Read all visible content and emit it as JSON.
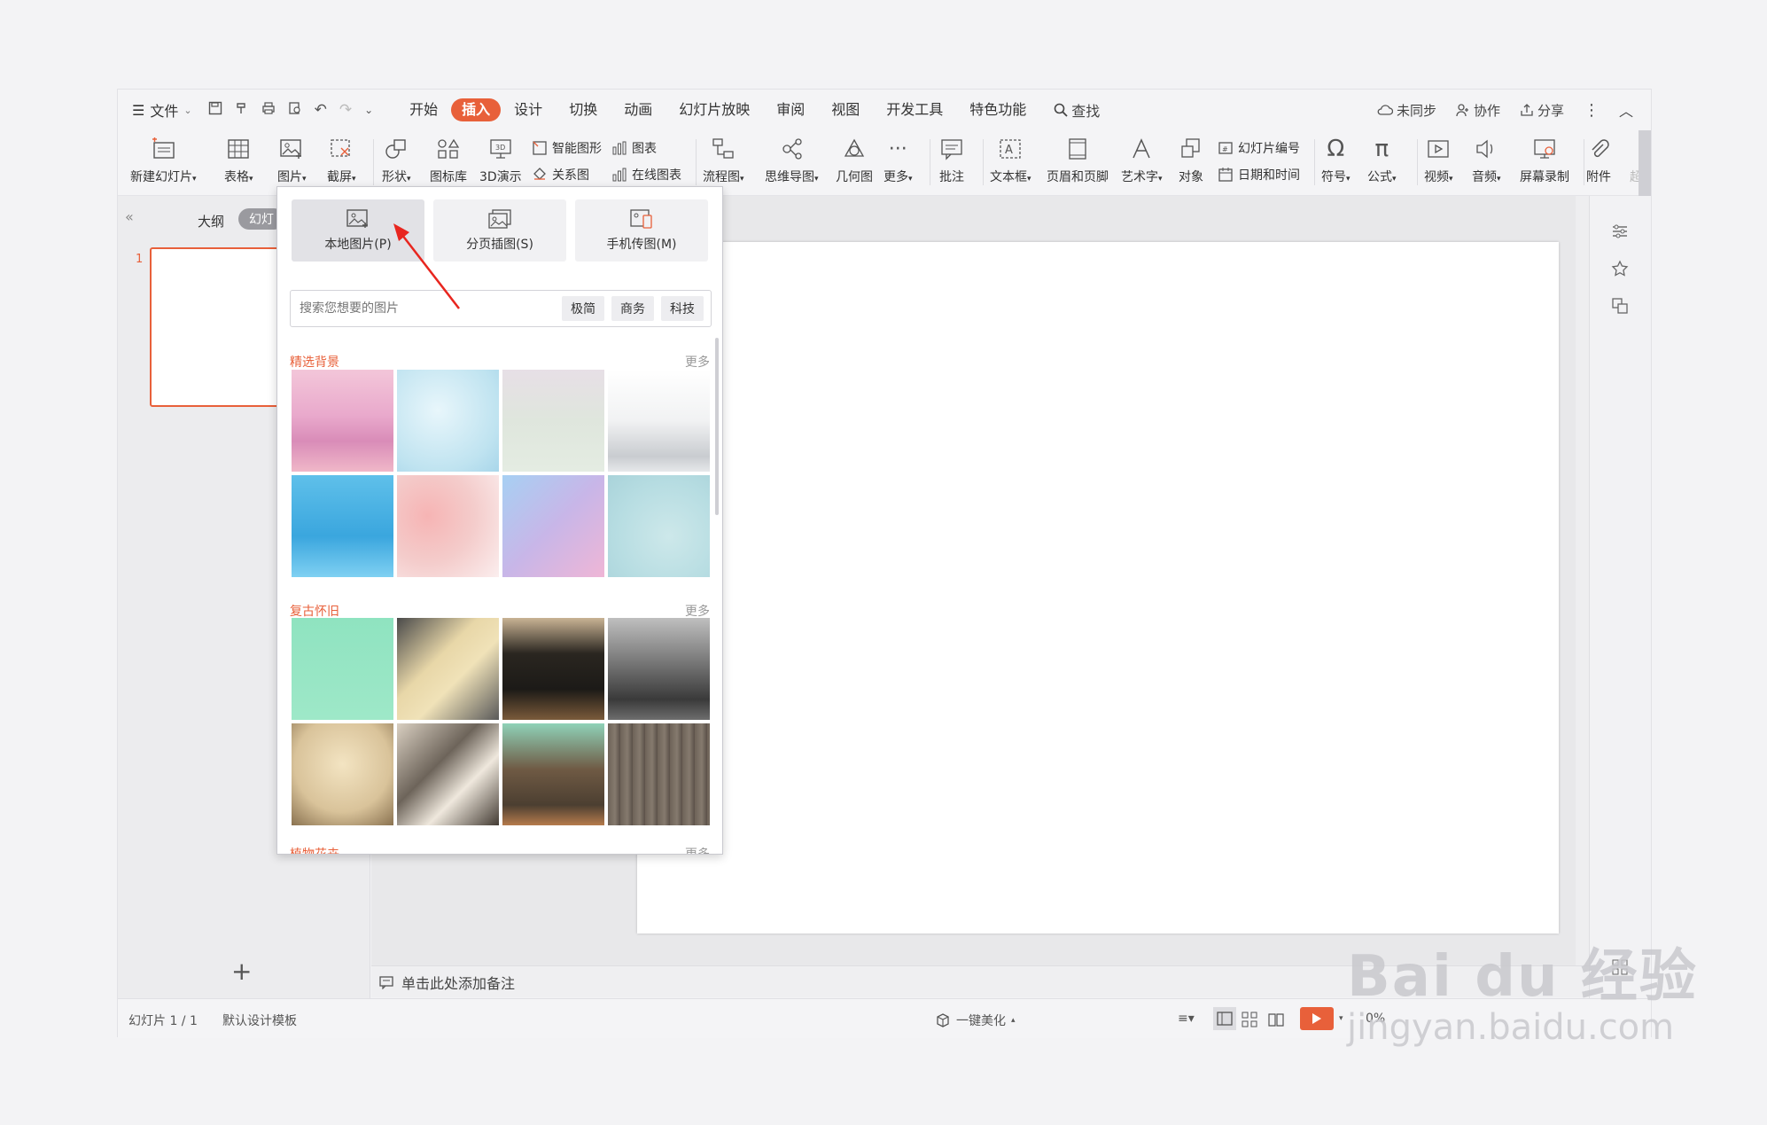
{
  "menubar": {
    "file_label": "文件",
    "tabs": [
      {
        "label": "开始"
      },
      {
        "label": "插入"
      },
      {
        "label": "设计"
      },
      {
        "label": "切换"
      },
      {
        "label": "动画"
      },
      {
        "label": "幻灯片放映"
      },
      {
        "label": "审阅"
      },
      {
        "label": "视图"
      },
      {
        "label": "开发工具"
      },
      {
        "label": "特色功能"
      }
    ],
    "search_label": "查找",
    "sync_label": "未同步",
    "collab_label": "协作",
    "share_label": "分享"
  },
  "ribbon": {
    "new_slide": "新建幻灯片",
    "table": "表格",
    "picture": "图片",
    "screenshot": "截屏",
    "shape": "形状",
    "icon_lib": "图标库",
    "demo3d": "3D演示",
    "smart_art": "智能图形",
    "chart": "图表",
    "relation": "关系图",
    "online_chart": "在线图表",
    "flowchart": "流程图",
    "mindmap": "思维导图",
    "geometry": "几何图",
    "more": "更多",
    "comment": "批注",
    "textbox": "文本框",
    "header_footer": "页眉和页脚",
    "wordart": "艺术字",
    "object": "对象",
    "slide_number": "幻灯片编号",
    "datetime": "日期和时间",
    "symbol": "符号",
    "formula": "公式",
    "video": "视频",
    "audio": "音频",
    "screen_record": "屏幕录制",
    "attachment": "附件",
    "hyperlink_partial": "超"
  },
  "leftpanel": {
    "outline": "大纲",
    "slides_tab": "幻灯",
    "slide_num": "1"
  },
  "popup": {
    "sources": [
      {
        "label": "本地图片(P)"
      },
      {
        "label": "分页插图(S)"
      },
      {
        "label": "手机传图(M)"
      }
    ],
    "search_placeholder": "搜索您想要的图片",
    "chips": [
      "极简",
      "商务",
      "科技"
    ],
    "sections": [
      {
        "title": "精选背景",
        "more": "更多"
      },
      {
        "title": "复古怀旧",
        "more": "更多"
      },
      {
        "title": "植物花卉",
        "more": "更多"
      }
    ]
  },
  "notes_placeholder": "单击此处添加备注",
  "status": {
    "slide_count": "幻灯片 1 / 1",
    "template": "默认设计模板",
    "beautify": "一键美化",
    "zoom": "0%"
  },
  "watermark": {
    "brand": "Bai  du 经验",
    "url": "jingyan.baidu.com"
  },
  "colors": {
    "accent": "#e8603a"
  }
}
